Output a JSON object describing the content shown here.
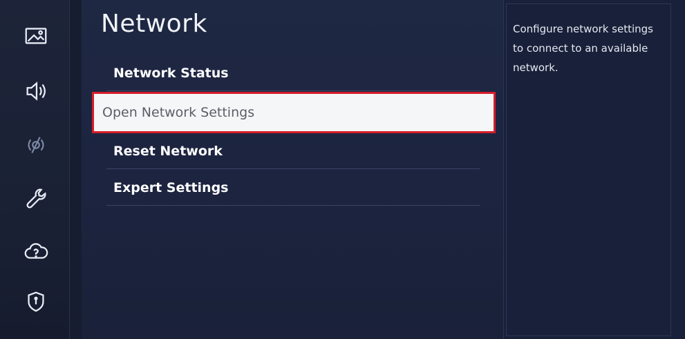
{
  "sidebar": {
    "icons": [
      {
        "name": "picture-icon"
      },
      {
        "name": "sound-icon"
      },
      {
        "name": "broadcasting-icon"
      },
      {
        "name": "general-wrench-icon"
      },
      {
        "name": "support-cloud-icon"
      },
      {
        "name": "privacy-shield-icon"
      }
    ]
  },
  "page": {
    "title": "Network"
  },
  "menu": {
    "items": [
      {
        "label": "Network Status"
      },
      {
        "label": "Open Network Settings",
        "selected": true
      },
      {
        "label": "Reset Network"
      },
      {
        "label": "Expert Settings"
      }
    ]
  },
  "description": {
    "text": "Configure network settings to connect to an available network."
  },
  "colors": {
    "highlight_border": "#d61d2a",
    "background": "#1c2440"
  }
}
